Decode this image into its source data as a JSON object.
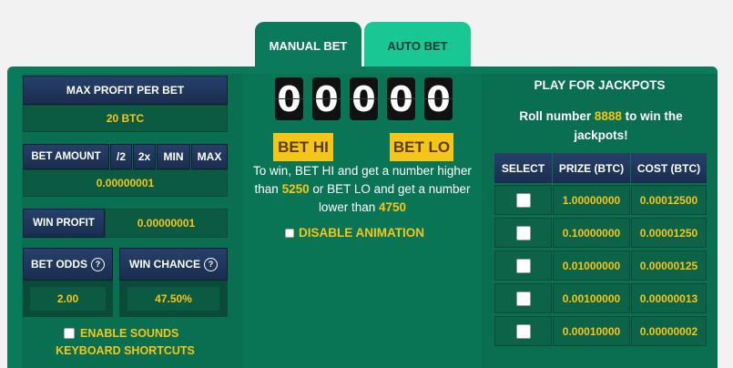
{
  "tabs": {
    "manual": "MANUAL BET",
    "auto": "AUTO BET"
  },
  "left": {
    "max_profit_label": "MAX PROFIT PER BET",
    "max_profit_value": "20 BTC",
    "bet_amount_label": "BET AMOUNT",
    "half": "/2",
    "double": "2x",
    "min": "MIN",
    "max": "MAX",
    "bet_amount_value": "0.00000001",
    "win_profit_label": "WIN PROFIT",
    "win_profit_value": "0.00000001",
    "bet_odds_label": "BET ODDS",
    "bet_odds_value": "2.00",
    "win_chance_label": "WIN CHANCE",
    "win_chance_value": "47.50%",
    "help": "?",
    "enable_sounds": "ENABLE SOUNDS",
    "keyboard_shortcuts": "KEYBOARD SHORTCUTS"
  },
  "middle": {
    "digits": [
      "0",
      "0",
      "0",
      "0",
      "0"
    ],
    "bet_hi": "BET HI",
    "bet_lo": "BET LO",
    "text1": "To win, BET HI and get a number higher than",
    "hi_number": "5250",
    "text2": "or BET LO and get a number lower than",
    "lo_number": "4750",
    "disable_animation": "DISABLE ANIMATION"
  },
  "right": {
    "title": "PLAY FOR JACKPOTS",
    "roll_pre": "Roll number",
    "roll_number": "8888",
    "roll_post": "to win the jackpots!",
    "headers": [
      "SELECT",
      "PRIZE (BTC)",
      "COST (BTC)"
    ],
    "rows": [
      {
        "prize": "1.00000000",
        "cost": "0.00012500"
      },
      {
        "prize": "0.10000000",
        "cost": "0.00001250"
      },
      {
        "prize": "0.01000000",
        "cost": "0.00000125"
      },
      {
        "prize": "0.00100000",
        "cost": "0.00000013"
      },
      {
        "prize": "0.00010000",
        "cost": "0.00000002"
      }
    ]
  },
  "colors": {
    "panel": "#0b7a5a",
    "accent": "#f5c518",
    "navy": "#1a2d4f",
    "tab_inactive": "#19c795"
  }
}
